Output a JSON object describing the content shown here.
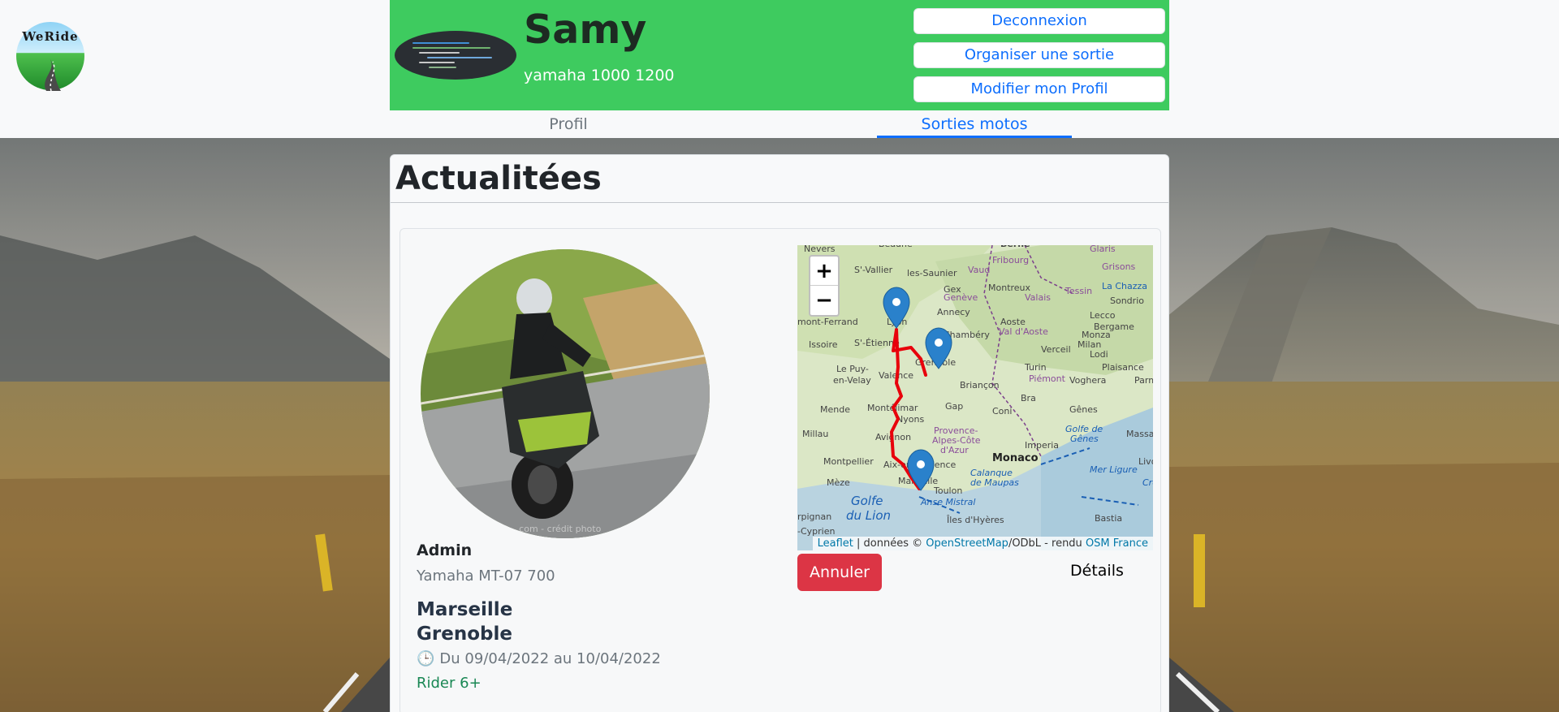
{
  "header": {
    "logo_text": "WeRide",
    "user_name": "Samy",
    "user_bike": "yamaha 1000 1200",
    "buttons": {
      "logout": "Deconnexion",
      "organize": "Organiser une sortie",
      "edit_profile": "Modifier mon Profil"
    }
  },
  "tabs": {
    "profile": "Profil",
    "rides": "Sorties motos",
    "active": "rides"
  },
  "feed": {
    "title": "Actualitées",
    "outing": {
      "author": "Admin",
      "author_bike": "Yamaha MT-07 700",
      "from": "Marseille",
      "to": "Grenoble",
      "clock_icon": "🕒",
      "dates": "Du 09/04/2022 au 10/04/2022",
      "level": "Rider 6+",
      "cancel_label": "Annuler",
      "details_label": "Détails",
      "map": {
        "zoom_in": "+",
        "zoom_out": "−",
        "attribution": {
          "leaflet": "Leaflet",
          "sep1": " | données © ",
          "osm": "OpenStreetMap",
          "sep2": "/ODbL - rendu ",
          "osmfr": "OSM France"
        },
        "places": [
          "Nevers",
          "Beaune",
          "Berne",
          "Glaris",
          "Grisons",
          "S'-Vallier",
          "les-Saunier",
          "Vaud",
          "Fribourg",
          "Montreux",
          "Valais",
          "Tessin",
          "La Chazza",
          "Genève",
          "Gex",
          "Sondrio",
          "Annecy",
          "Lecco",
          "Bergame",
          "Lyon",
          "Aoste",
          "Monza",
          "Chambéry",
          "Val d'Aoste",
          "Milan",
          "Issoire",
          "S'-Étienne",
          "Grenoble",
          "Verceil",
          "Lodi",
          "Plaisance",
          "Le Puy-en-Velay",
          "Valence",
          "Briançon",
          "Turin",
          "Piémont",
          "Voghera",
          "Parme",
          "Mende",
          "Gap",
          "Coni",
          "Bra",
          "Gênes",
          "Montélimar",
          "Nyons",
          "Provence-Alpes-Côte d'Azur",
          "Golfe de Gênes",
          "Massa",
          "Millau",
          "Avignon",
          "Imperia",
          "Montpellier",
          "Aix-en-Provence",
          "Monaco",
          "Mer Ligure",
          "Livourne",
          "Mèze",
          "Marseille",
          "Calanque de Maupas",
          "Toulon",
          "Crep",
          "Golfe du Lion",
          "Anse Mistral",
          "Îles d'Hyères",
          "Bastia",
          "Perpignan",
          "Cyprien",
          "mont-Ferrand"
        ]
      }
    }
  },
  "colors": {
    "banner_green": "#3ecb5f",
    "primary_blue": "#0d6efd",
    "danger_red": "#dc3545",
    "success_green": "#198754",
    "route_red": "#e8000b",
    "marker_blue": "#2a81cb"
  }
}
